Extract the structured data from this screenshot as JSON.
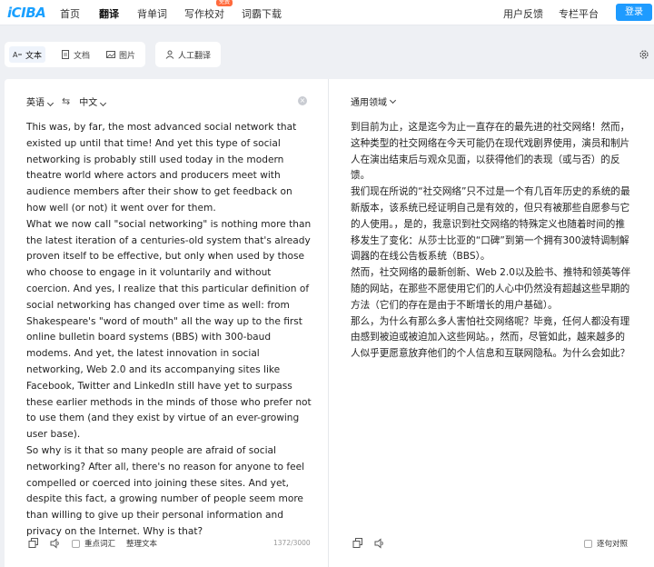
{
  "nav": {
    "logo": "iCIBA",
    "items": [
      "首页",
      "翻译",
      "背单词",
      "写作校对",
      "词霸下载"
    ],
    "badge": "免费",
    "feedback": "用户反馈",
    "pro": "专栏平台",
    "login": "登录"
  },
  "modes": {
    "text": "文本",
    "doc": "文档",
    "image": "图片",
    "human": "人工翻译"
  },
  "source": {
    "from_lang": "英语",
    "to_lang": "中文",
    "paragraphs": [
      "This was, by far, the most advanced social network that existed up until that time! And yet this type of social networking is probably still used today in the modern theatre world where actors and producers meet with audience members after their show to get feedback on how well (or not) it went over for them.",
      "What we now call \"social networking\" is nothing more than the latest iteration of a centuries-old system that's already proven itself to be effective, but only when used by those who choose to engage in it voluntarily and without coercion. And yes, I realize that this particular definition of social networking has changed over time as well: from Shakespeare's \"word of mouth\" all the way up to the first online bulletin board systems (BBS) with 300-baud modems. And yet, the latest innovation in social networking, Web 2.0 and its accompanying sites like Facebook, Twitter and LinkedIn still have yet to surpass these earlier methods in the minds of those who prefer not to use them (and they exist by virtue of an ever-growing user base).",
      "So why is it that so many people are afraid of social networking? After all, there's no reason for anyone to feel compelled or coerced into joining these sites. And yet, despite this fact, a growing number of people seem more than willing to give up their personal information and privacy on the Internet. Why is that?"
    ],
    "key_vocab": "重点词汇",
    "organize": "整理文本",
    "counter": "1372/3000"
  },
  "target": {
    "domain": "通用领域",
    "paragraphs": [
      "到目前为止，这是迄今为止一直存在的最先进的社交网络！然而，这种类型的社交网络在今天可能仍在现代戏剧界使用，演员和制片人在演出结束后与观众见面，以获得他们的表现（或与否）的反馈。",
      "我们现在所说的“社交网络”只不过是一个有几百年历史的系统的最新版本，该系统已经证明自己是有效的，但只有被那些自愿参与它的人使用。，是的，我意识到社交网络的特殊定义也随着时间的推移发生了变化：从莎士比亚的“口碑”到第一个拥有300波特调制解调器的在线公告板系统（BBS）。",
      "然而，社交网络的最新创新、Web 2.0以及脸书、推特和领英等伴随的网站，在那些不愿使用它们的人心中仍然没有超越这些早期的方法（它们的存在是由于不断增长的用户基础）。",
      "那么，为什么有那么多人害怕社交网络呢？毕竟，任何人都没有理由感到被迫或被迫加入这些网站。，然而，尽管如此，越来越多的人似乎更愿意放弃他们的个人信息和互联网隐私。为什么会如此？"
    ],
    "compare": "逐句对照"
  },
  "colors": {
    "accent": "#1e9bff",
    "badge": "#ff6a3d",
    "background": "#eef0f4"
  }
}
